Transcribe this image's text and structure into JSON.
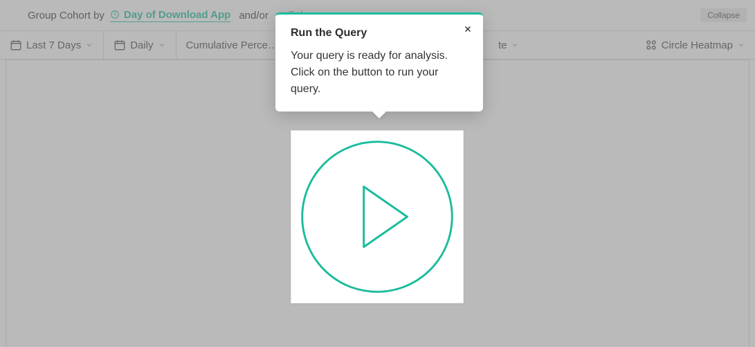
{
  "cohort": {
    "group_label": "Group Cohort by",
    "chip_label": "Day of Download App",
    "andor_label": "and/or",
    "add_label": "Sel…"
  },
  "collapse_label": "Collapse",
  "toolbar": {
    "range": "Last 7 Days",
    "interval": "Daily",
    "metric": "Cumulative Perce…",
    "extra_partial": "te",
    "viz": "Circle Heatmap"
  },
  "tooltip": {
    "title": "Run the Query",
    "body": "Your query is ready for analysis. Click on the button to run your query."
  },
  "colors": {
    "teal": "#1abc9c"
  }
}
